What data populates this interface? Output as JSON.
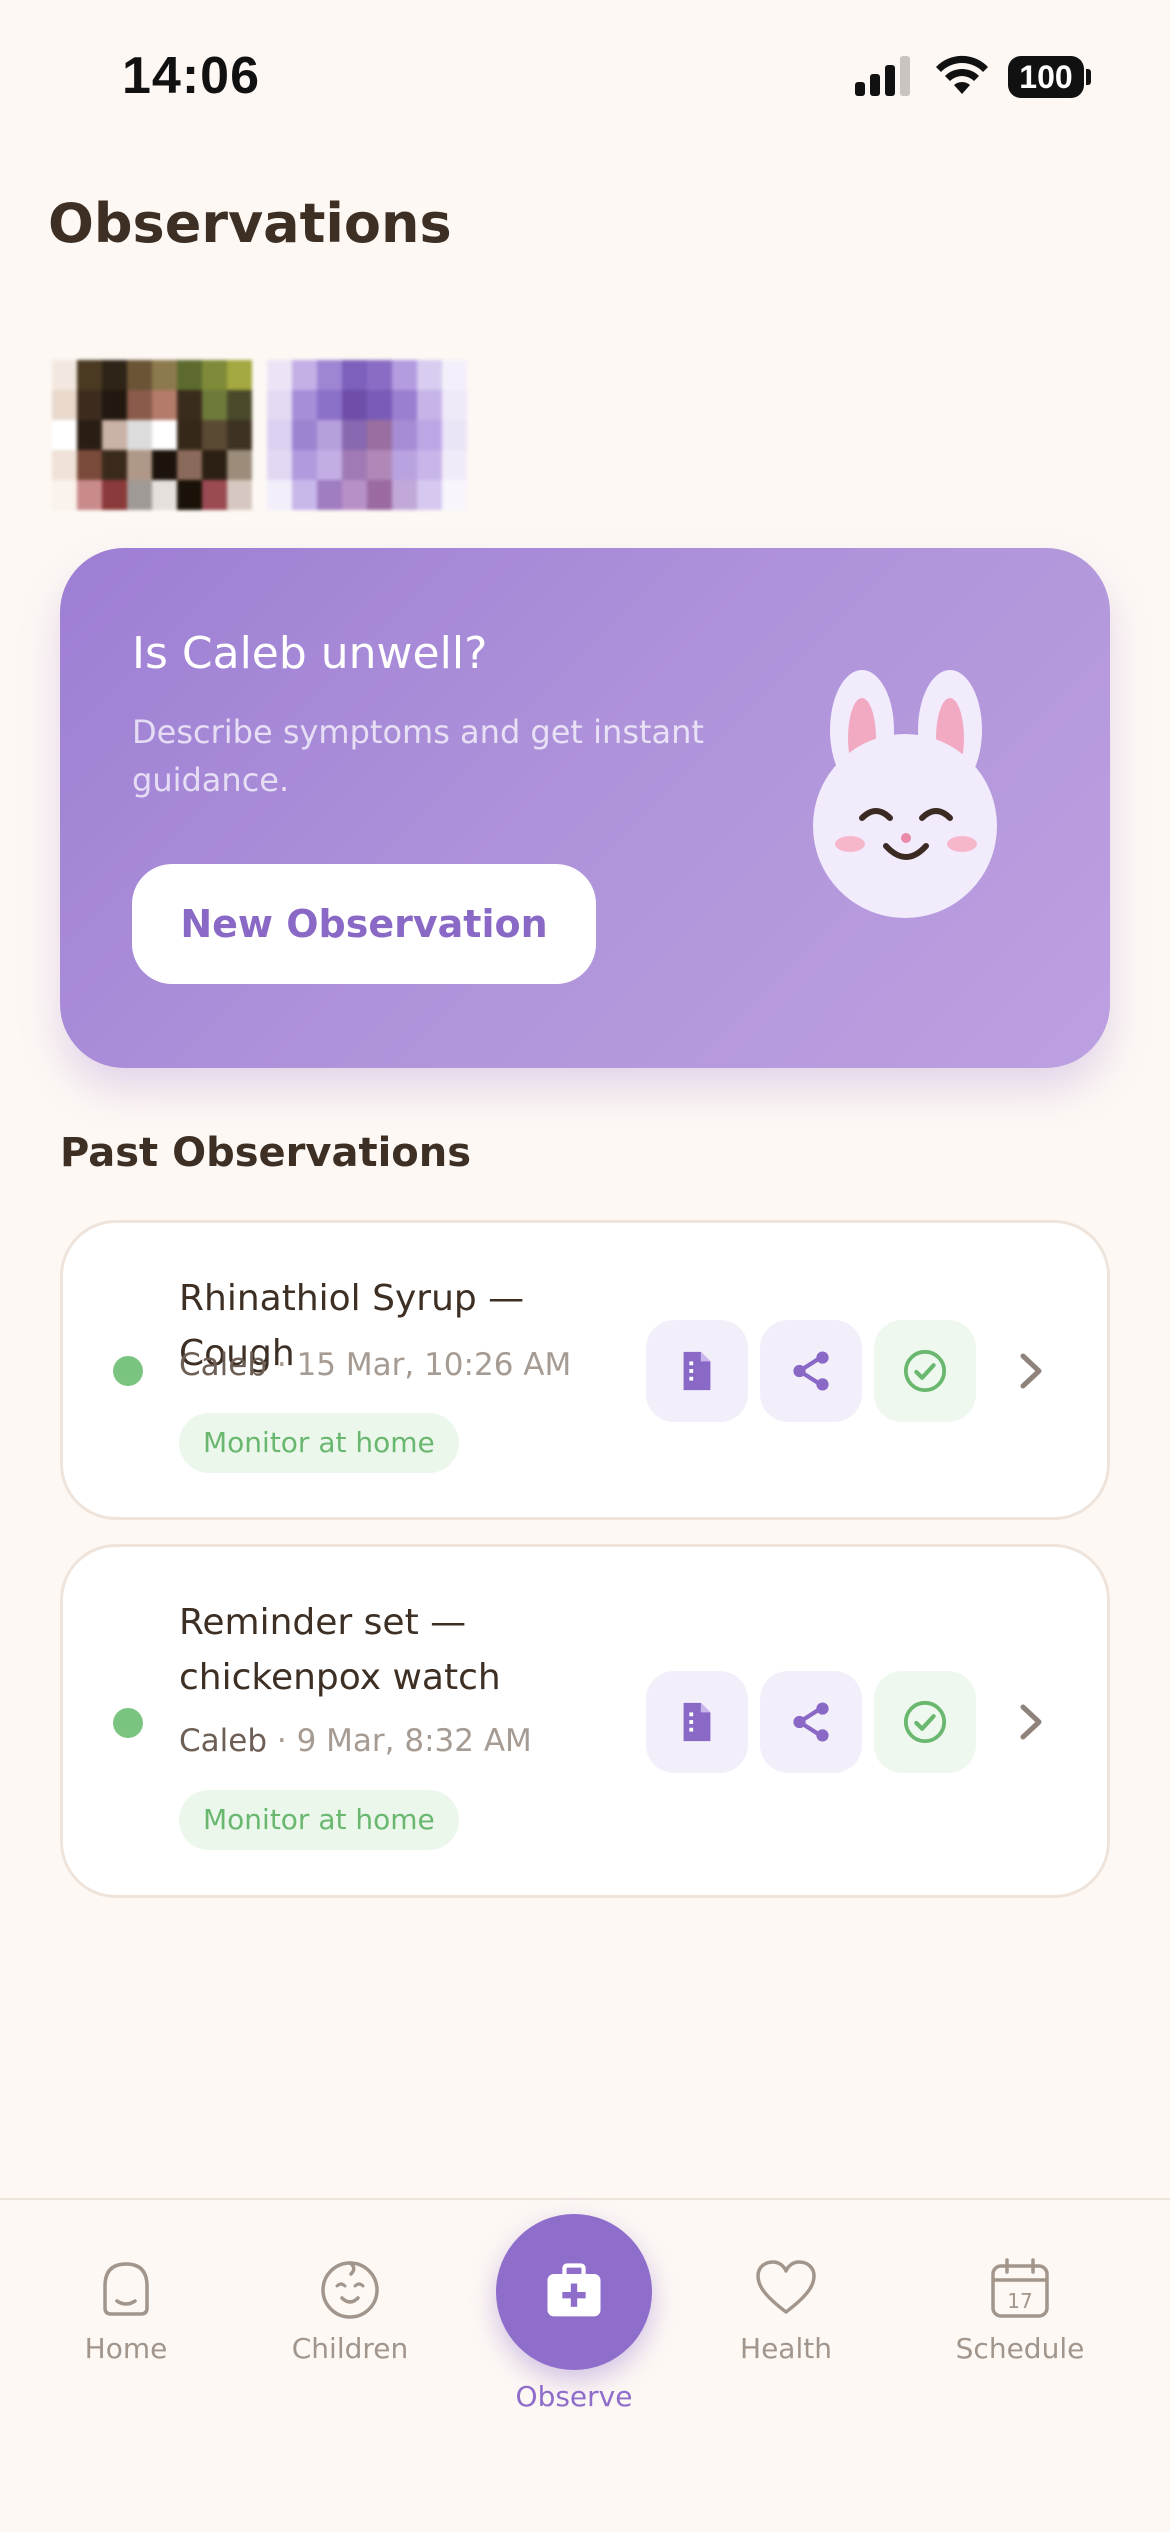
{
  "status_bar": {
    "time": "14:06",
    "battery": "100"
  },
  "page": {
    "title": "Observations"
  },
  "hero": {
    "title": "Is Caleb unwell?",
    "subtitle": "Describe symptoms and get instant guidance.",
    "button_label": "New Observation"
  },
  "past": {
    "title": "Past Observations",
    "items": [
      {
        "title": "Rhinathiol Syrup — Cough",
        "child": "Caleb",
        "separator": " · ",
        "date": "15 Mar, 10:26 AM",
        "tag": "Monitor at home",
        "status_color": "#7bc47f"
      },
      {
        "title": "Reminder set — chickenpox watch",
        "child": "Caleb",
        "separator": " · ",
        "date": "9 Mar, 8:32 AM",
        "tag": "Monitor at home",
        "status_color": "#7bc47f"
      }
    ],
    "actions": [
      "document-icon",
      "share-icon",
      "check-circle-icon",
      "chevron-right-icon"
    ]
  },
  "nav": {
    "items": [
      {
        "label": "Home",
        "icon": "home-icon"
      },
      {
        "label": "Children",
        "icon": "baby-face-icon"
      },
      {
        "label": "Observe",
        "icon": "medical-kit-icon"
      },
      {
        "label": "Health",
        "icon": "heart-icon"
      },
      {
        "label": "Schedule",
        "icon": "calendar-icon"
      }
    ],
    "calendar_day": "17",
    "active": "Observe"
  },
  "colors": {
    "accent": "#8f6dca",
    "hero_gradient_start": "#9d7ed4",
    "hero_gradient_end": "#bca0e0",
    "status_green": "#7bc47f",
    "background": "#fdf8f4"
  }
}
